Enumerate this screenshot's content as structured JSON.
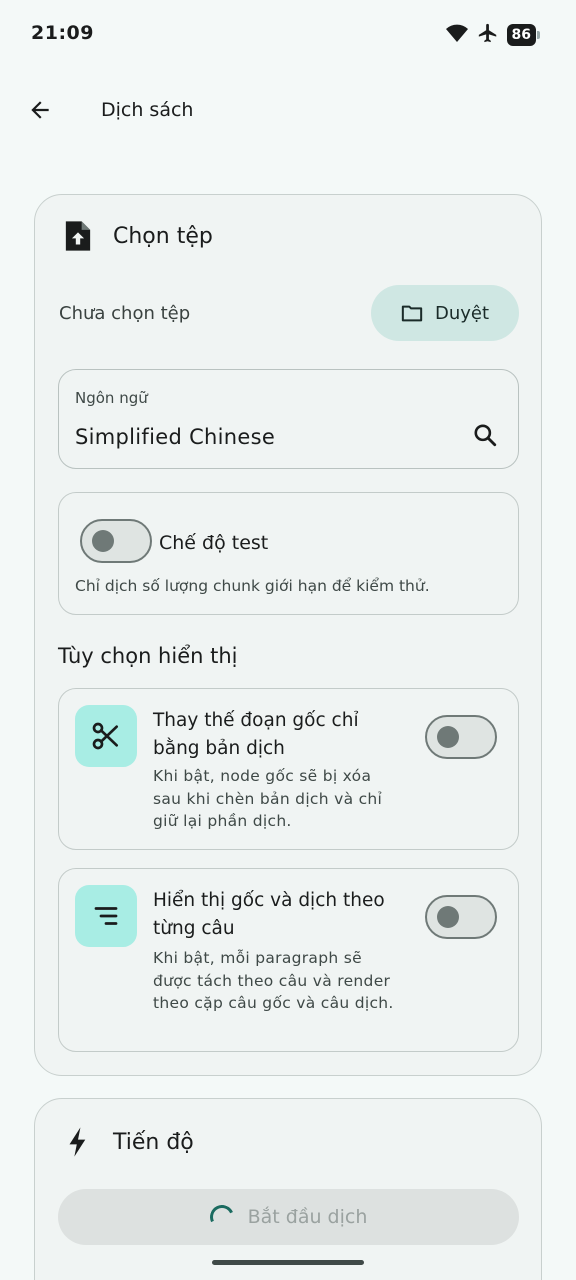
{
  "status": {
    "time": "21:09",
    "battery": "86",
    "icons": [
      "wifi-icon",
      "airplane-icon",
      "battery-icon"
    ]
  },
  "appbar": {
    "title": "Dịch sách"
  },
  "file_card": {
    "title": "Chọn tệp",
    "file_status": "Chưa chọn tệp",
    "browse_label": "Duyệt",
    "language": {
      "label": "Ngôn ngữ",
      "value": "Simplified Chinese"
    },
    "test_mode": {
      "label": "Chế độ test",
      "description": "Chỉ dịch số lượng chunk giới hạn để kiểm thử.",
      "enabled": false
    },
    "display_options": {
      "title": "Tùy chọn hiển thị",
      "items": [
        {
          "icon": "scissors-icon",
          "title": "Thay thế đoạn gốc chỉ bằng bản dịch",
          "description": "Khi bật, node gốc sẽ bị xóa sau khi chèn bản dịch và chỉ giữ lại phần dịch.",
          "enabled": false
        },
        {
          "icon": "align-lines-icon",
          "title": "Hiển thị gốc và dịch theo từng câu",
          "description": "Khi bật, mỗi paragraph sẽ được tách theo câu và render theo cặp câu gốc và câu dịch.",
          "enabled": false
        }
      ]
    }
  },
  "progress_card": {
    "title": "Tiến độ",
    "start_label": "Bắt đầu dịch"
  },
  "colors": {
    "background": "#f4f9f8",
    "accent_container": "#cfe7e3",
    "icon_container": "#a8ede4",
    "spinner": "#1b6b60"
  }
}
